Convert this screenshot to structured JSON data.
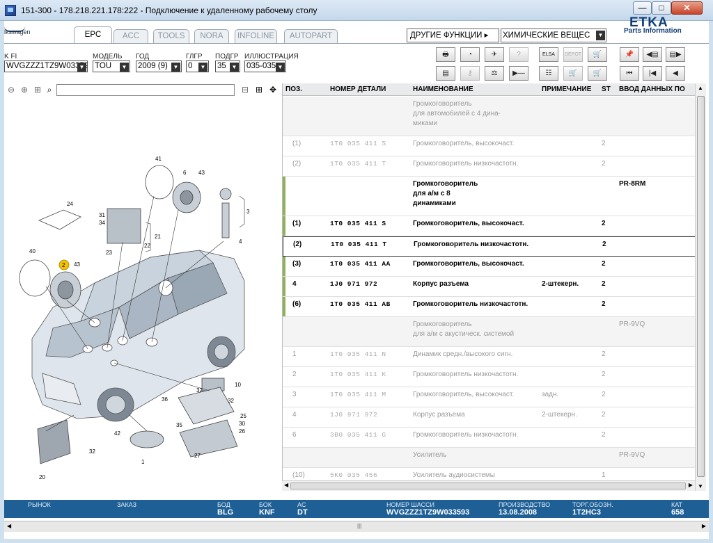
{
  "window": {
    "title": "151-300 - 178.218.221.178:222 - Подключение к удаленному рабочему столу",
    "min": "—",
    "max": "□",
    "close": "✕"
  },
  "brand": {
    "left": "lkswagen",
    "logo_big": "ETKA",
    "logo_sub": "Parts Information"
  },
  "tabs": [
    "EPC",
    "ACC",
    "TOOLS",
    "NORA",
    "INFOLINE",
    "AUTOPART"
  ],
  "functions": {
    "label": "ДРУГИЕ ФУНКЦИИ ▸",
    "value": "ХИМИЧЕСКИЕ ВЕЩЕС"
  },
  "fields": {
    "vin_label": "K FI",
    "vin": "WVGZZZ1TZ9W03359",
    "model_label": "МОДЕЛЬ",
    "model": "TOU",
    "year_label": "ГОД",
    "year": "2009 (9)",
    "hg_label": "ГЛГР",
    "hg": "0",
    "ug_label": "ПОДГР",
    "ug": "35",
    "ill_label": "ИЛЛЮСТРАЦИЯ",
    "ill": "035-035"
  },
  "toolbar_icons": {
    "elsa": "ELSA",
    "depot": "DEPOT"
  },
  "table": {
    "headers": [
      "ПОЗ.",
      "НОМЕР ДЕТАЛИ",
      "НАИМЕНОВАНИЕ",
      "ПРИМЕЧАНИЕ",
      "ST",
      "ВВОД ДАННЫХ ПО"
    ],
    "rows": [
      {
        "pos": "",
        "num": "",
        "name": "Громкоговоритель\nдля автомобилей с 4 дина-\nмиками",
        "note": "",
        "st": "",
        "data": ""
      },
      {
        "pos": "(1)",
        "num": "1T0 035 411 S",
        "name": "Громкоговоритель, высокочаст.",
        "note": "",
        "st": "2",
        "data": ""
      },
      {
        "pos": "(2)",
        "num": "1T0 035 411 T",
        "name": "Громкоговоритель низкочастотн.",
        "note": "",
        "st": "2",
        "data": ""
      },
      {
        "pos": "",
        "num": "",
        "name": "Громкоговоритель\nдля а/м с 8\nдинамиками",
        "note": "",
        "st": "",
        "data": "PR-8RM"
      },
      {
        "pos": "(1)",
        "num": "1T0 035 411 S",
        "name": "Громкоговоритель, высокочаст.",
        "note": "",
        "st": "2",
        "data": ""
      },
      {
        "pos": "(2)",
        "num": "1T0 035 411 T",
        "name": "Громкоговоритель низкочастотн.",
        "note": "",
        "st": "2",
        "data": ""
      },
      {
        "pos": "(3)",
        "num": "1T0 035 411 AA",
        "name": "Громкоговоритель, высокочаст.",
        "note": "",
        "st": "2",
        "data": ""
      },
      {
        "pos": "4",
        "num": "1J0 971 972",
        "name": "Корпус разъема",
        "note": "2-штекерн.",
        "st": "2",
        "data": ""
      },
      {
        "pos": "(6)",
        "num": "1T0 035 411 AB",
        "name": "Громкоговоритель низкочастотн.",
        "note": "",
        "st": "2",
        "data": ""
      },
      {
        "pos": "",
        "num": "",
        "name": "Громкоговоритель\nдля а/м с акустическ. системой",
        "note": "",
        "st": "",
        "data": "PR-9VQ"
      },
      {
        "pos": "1",
        "num": "1T0 035 411 N",
        "name": "Динамик средн./высокого сигн.",
        "note": "",
        "st": "2",
        "data": ""
      },
      {
        "pos": "2",
        "num": "1T0 035 411 K",
        "name": "Громкоговоритель низкочастотн.",
        "note": "",
        "st": "2",
        "data": ""
      },
      {
        "pos": "3",
        "num": "1T0 035 411 M",
        "name": "Громкоговоритель, высокочаст.",
        "note": "задн.",
        "st": "2",
        "data": ""
      },
      {
        "pos": "4",
        "num": "1J0 971 972",
        "name": "Корпус разъема",
        "note": "2-штекерн.",
        "st": "2",
        "data": ""
      },
      {
        "pos": "6",
        "num": "3B0 035 411 G",
        "name": "Громкоговоритель низкочастотн.",
        "note": "",
        "st": "2",
        "data": ""
      },
      {
        "pos": "",
        "num": "",
        "name": "Усилитель",
        "note": "",
        "st": "",
        "data": "PR-9VQ"
      },
      {
        "pos": "(10)",
        "num": "5K0 035 456",
        "name": "Усилитель аудиосистемы",
        "note": "",
        "st": "1",
        "data": ""
      }
    ]
  },
  "diagram_labels": {
    "n41": "41",
    "n6": "6",
    "n43a": "43",
    "n24": "24",
    "n3": "3",
    "n31": "31",
    "n34": "34",
    "n21": "21",
    "n22": "22",
    "n23": "23",
    "n4": "4",
    "n40": "40",
    "n2": "2",
    "n43b": "43",
    "n10": "10",
    "n32a": "32",
    "n36": "36",
    "n32b": "32",
    "n25": "25",
    "n35": "35",
    "n30": "30",
    "n42": "42",
    "n26": "26",
    "n27": "27",
    "n32c": "32",
    "n1": "1",
    "n20": "20"
  },
  "status": {
    "market_label": "РЫНОК",
    "order_label": "ЗАКАЗ",
    "body_label": "БОД",
    "body": "BLG",
    "box_label": "БОК",
    "box": "KNF",
    "ac_label": "AC",
    "ac": "DT",
    "chassis_label": "НОМЕР ШАССИ",
    "chassis": "WVGZZZ1TZ9W033593",
    "prod_label": "ПРОИЗВОДСТВО",
    "prod": "13.08.2008",
    "trade_label": "ТОРГ.ОБОЗН.",
    "trade": "1T2HC3",
    "cat_label": "КАТ",
    "cat": "658"
  },
  "colors": {
    "status_bg": "#1e5f96",
    "mark_green": "#8fb15a",
    "brand_blue": "#123e75"
  }
}
